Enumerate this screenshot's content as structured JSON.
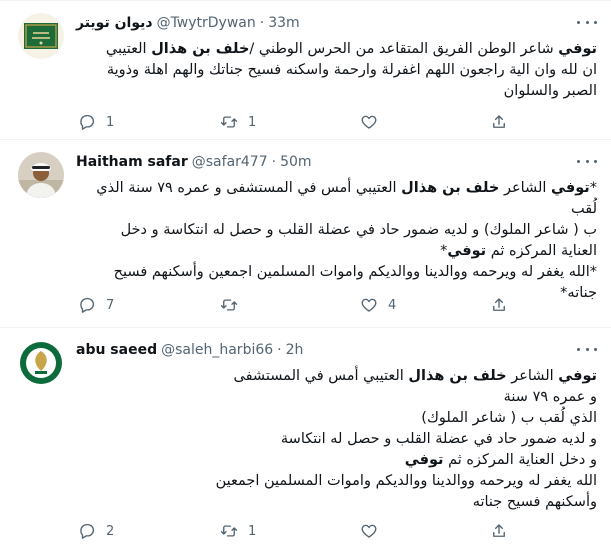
{
  "tweets": [
    {
      "name": "ديوان تويتر",
      "handle": "@TwytrDywan",
      "sep": "·",
      "time": "33m",
      "body": {
        "l1a": "توفي",
        "l1b": " شاعر الوطن الفريق المتقاعد من الحرس الوطني /",
        "l1c": "خلف بن هذال",
        "l1d": " العتيبي",
        "l2": "ان لله وان الية راجعون اللهم اغفرلة وارحمة واسكنه فسيح جناتك والهم اهلة وذوية",
        "l3": "الصبر والسلوان"
      },
      "counts": {
        "reply": "1",
        "retweet": "1",
        "like": "",
        "share": ""
      }
    },
    {
      "name": "Haitham safar",
      "handle": "@safar477",
      "sep": "·",
      "time": "50m",
      "body": {
        "l1a": "*",
        "l1b": "توفي",
        "l1c": " الشاعر ",
        "l1d": "خلف بن هذال",
        "l1e": " العتيبي أمس في المستشفى و عمره ٧٩ سنة الذي لُقب",
        "l2": "ب ( شاعر الملوك) و لديه ضمور حاد في عضلة القلب و حصل له انتكاسة و دخل",
        "l3a": "العناية المركزه ثم ",
        "l3b": "توفي",
        "l3c": "*",
        "l4": "*الله يغفر له ويرحمه ووالدينا ووالديكم واموات المسلمين اجمعين وأسكنهم فسيح",
        "l5": "جناته*"
      },
      "counts": {
        "reply": "7",
        "retweet": "",
        "like": "4",
        "share": ""
      }
    },
    {
      "name": "abu saeed",
      "handle": "@saleh_harbi66",
      "sep": "·",
      "time": "2h",
      "body": {
        "l1a": "توفي",
        "l1b": " الشاعر ",
        "l1c": "خلف بن هذال",
        "l1d": " العتيبي أمس في المستشفى",
        "l2": "و عمره ٧٩ سنة",
        "l3": "الذي لُقب ب ( شاعر الملوك)",
        "l4": "و لديه ضمور حاد في عضلة القلب و حصل له انتكاسة",
        "l5a": "و دخل العناية المركزه ثم ",
        "l5b": "توفي",
        "l6": "الله يغفر له ويرحمه ووالدينا ووالديكم واموات المسلمين اجمعين",
        "l7": "وأسكنهم فسيح جناته"
      },
      "counts": {
        "reply": "2",
        "retweet": "1",
        "like": "",
        "share": ""
      }
    }
  ],
  "icons": {
    "reply": "reply-icon",
    "retweet": "retweet-icon",
    "like": "heart-icon",
    "share": "share-icon",
    "more": "more-icon"
  },
  "colors": {
    "text": "#0f1419",
    "secondary": "#536471",
    "border": "#eff3f4",
    "logo_green": "#1e6b3a"
  }
}
